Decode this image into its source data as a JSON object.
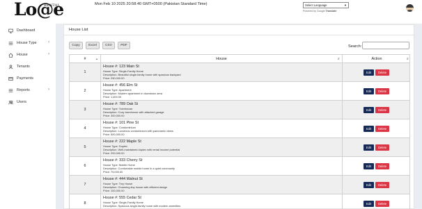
{
  "header": {
    "logo_main": "Lo@e",
    "logo_sub": "RENTAL",
    "datetime": "Mon Feb 10 2025 20:58:40 GMT+0500 (Pakistan Standard Time)",
    "language_select": "Select Language",
    "powered_by": "Powered by",
    "google": "Google",
    "translate": "Translate",
    "avatar_icon": "user-avatar"
  },
  "sidebar": {
    "items": [
      {
        "label": "Dashboard",
        "icon": "monitor-icon",
        "has_children": false
      },
      {
        "label": "House Type",
        "icon": "list-icon",
        "has_children": true
      },
      {
        "label": "House",
        "icon": "home-icon",
        "has_children": true
      },
      {
        "label": "Tenants",
        "icon": "user-icon",
        "has_children": false
      },
      {
        "label": "Payments",
        "icon": "card-icon",
        "has_children": false
      },
      {
        "label": "Reports",
        "icon": "list-icon",
        "has_children": true
      },
      {
        "label": "Users",
        "icon": "users-icon",
        "has_children": false
      }
    ]
  },
  "main": {
    "title": "House List",
    "export_buttons": [
      "Copy",
      "Excel",
      "CSV",
      "PDF"
    ],
    "search_label": "Search:",
    "search_value": "",
    "columns": [
      "#",
      "House",
      "Action"
    ],
    "rows": [
      {
        "num": "1",
        "title": "House #: 123 Main St",
        "type": "House Type: Single-Family Home",
        "desc": "Description: Beautiful single-family home with spacious backyard",
        "price": "Price: 250,000.00"
      },
      {
        "num": "2",
        "title": "House #: 456 Elm St",
        "type": "House Type: Apartment",
        "desc": "Description: Modern apartment in downtown area",
        "price": "Price: 1,500.00"
      },
      {
        "num": "3",
        "title": "House #: 789 Oak St",
        "type": "House Type: Townhouse",
        "desc": "Description: Cozy townhouse with attached garage",
        "price": "Price: 300,000.00"
      },
      {
        "num": "4",
        "title": "House #: 101 Pine St",
        "type": "House Type: Condominium",
        "desc": "Description: Luxurious condominium with panoramic views",
        "price": "Price: 500,000.00"
      },
      {
        "num": "5",
        "title": "House #: 222 Maple St",
        "type": "House Type: Duplex",
        "desc": "Description: Well-maintained duplex with rental income potential",
        "price": "Price: 200,000.00"
      },
      {
        "num": "6",
        "title": "House #: 333 Cherry St",
        "type": "House Type: Mobile Home",
        "desc": "Description: Comfortable mobile home in a quiet community",
        "price": "Price: 75,000.00"
      },
      {
        "num": "7",
        "title": "House #: 444 Walnut St",
        "type": "House Type: Tiny House",
        "desc": "Description: Charming tiny house with efficient design",
        "price": "Price: 100,000.00"
      },
      {
        "num": "8",
        "title": "House #: 555 Cedar St",
        "type": "House Type: Single-Family Home",
        "desc": "Description: Spacious single-family home with modern amenities",
        "price": ""
      }
    ],
    "edit_label": "Edit",
    "delete_label": "Delete"
  },
  "colors": {
    "edit_button": "#162a57",
    "delete_button": "#dc3545",
    "page_background": "#e9ecf0"
  }
}
